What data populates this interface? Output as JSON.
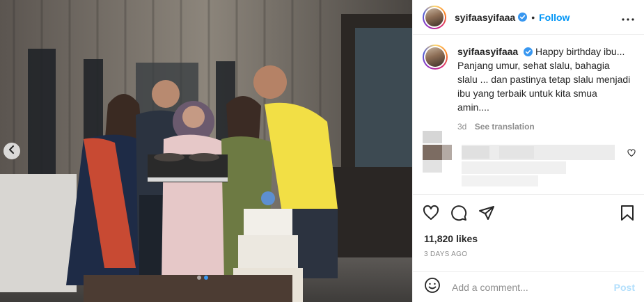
{
  "header": {
    "username": "syifaasyifaaa",
    "separator": "•",
    "follow_label": "Follow",
    "more_label": "•••"
  },
  "caption": {
    "username": "syifaasyifaaa",
    "text": "Happy birthday ibu... Panjang umur, sehat slalu, bahagia slalu ... dan pastinya tetap slalu menjadi ibu yang terbaik untuk kita smua amin....",
    "age": "3d",
    "see_translation": "See translation"
  },
  "stats": {
    "likes": "11,820 likes",
    "time_ago": "3 DAYS AGO"
  },
  "comment": {
    "placeholder": "Add a comment...",
    "post_label": "Post"
  },
  "carousel": {
    "slide_count": 2,
    "active_index": 0
  },
  "colors": {
    "accent": "#0095f6",
    "post_disabled": "#b2dffc",
    "muted": "#8e8e8e",
    "active_dot": "#3897f0"
  },
  "icons": [
    "verified-badge-icon",
    "more-options-icon",
    "chevron-left-icon",
    "heart-icon",
    "comment-icon",
    "share-icon",
    "bookmark-icon",
    "emoji-icon"
  ]
}
